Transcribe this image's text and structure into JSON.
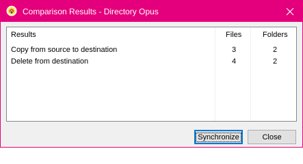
{
  "window": {
    "title": "Comparison Results - Directory Opus",
    "accent": "#e4007c"
  },
  "table": {
    "headers": {
      "results": "Results",
      "files": "Files",
      "folders": "Folders"
    },
    "rows": [
      {
        "label": "Copy from source to destination",
        "files": "3",
        "folders": "2"
      },
      {
        "label": "Delete from destination",
        "files": "4",
        "folders": "2"
      }
    ]
  },
  "buttons": {
    "synchronize": "Synchronize",
    "close": "Close"
  },
  "icons": {
    "app": "directory-opus-app-icon",
    "close": "close-icon"
  }
}
